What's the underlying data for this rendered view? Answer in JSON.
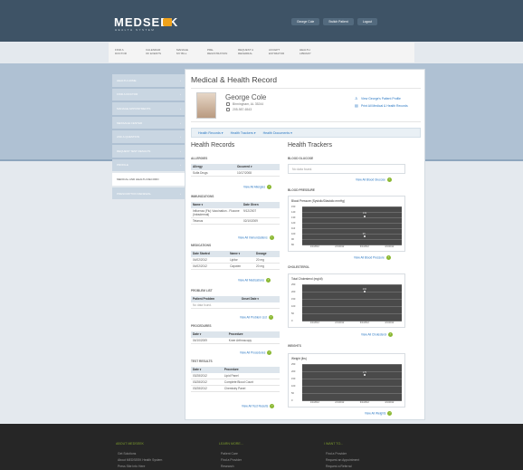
{
  "header": {
    "logo": "MEDSEEK",
    "logo_sub": "HEALTH SYSTEM",
    "user_links": [
      "George Cole",
      "Switch Patient",
      "Logout"
    ]
  },
  "topnav": [
    "FIND A\nDOCTOR",
    "CALENDAR\nOF EVENTS",
    "MANAGE\nMY BILL",
    "PRE-\nREGISTRATION",
    "REQUEST A\nREFERRAL",
    "ACCEPT\nESTIMATOR",
    "HEALTH\nLIBRARY"
  ],
  "sidebar": [
    "HEALTH HOME",
    "FIND A DOCTOR",
    "MANAGE APPOINTMENTS",
    "MESSAGE CENTER",
    "ASK A QUESTION",
    "REQUEST TEST RESULTS",
    "PROFILE",
    "MEDICAL AND HEALTH RECORD",
    "PRESCRIPTION RENEWAL"
  ],
  "main": {
    "title": "Medical & Health Record"
  },
  "profile": {
    "name": "George Cole",
    "address": "Birmingham, AL 35244",
    "phone": "205-987-6543",
    "link1": "View George's Patient Profile",
    "link2": "Print All Medical & Health Records"
  },
  "tabs": [
    "Health Records",
    "Health Trackers",
    "Health Documents"
  ],
  "records": {
    "heading": "Health Records",
    "allergies": {
      "title": "ALLERGIES",
      "headers": [
        "Allergy",
        "Occurred"
      ],
      "rows": [
        [
          "Sulfa Drugs",
          "10/17/2008"
        ]
      ],
      "link": "View All Allergies"
    },
    "immunizations": {
      "title": "IMMUNIZATIONS",
      "headers": [
        "Name",
        "Date Given"
      ],
      "rows": [
        [
          "Influenza (Flu) Vaccination - Fluzone (Intradermal)",
          "9/12/2007"
        ],
        [
          "Tetanus",
          "02/10/2009"
        ]
      ],
      "link": "View All Immunizations"
    },
    "medications": {
      "title": "MEDICATIONS",
      "headers": [
        "Date Started",
        "Name",
        "Dosage"
      ],
      "rows": [
        [
          "04/02/2012",
          "Lipitor",
          "20 mg"
        ],
        [
          "04/02/2012",
          "Capoten",
          "20 mg"
        ]
      ],
      "link": "View All Medications"
    },
    "problems": {
      "title": "PROBLEM LIST",
      "headers": [
        "Patient Problem",
        "Onset Date"
      ],
      "empty": "No data found.",
      "link": "View All Problem List"
    },
    "procedures": {
      "title": "PROCEDURES",
      "headers": [
        "Date",
        "Procedure"
      ],
      "rows": [
        [
          "04/10/2009",
          "Knee Arthroscopy"
        ]
      ],
      "link": "View All Procedures"
    },
    "tests": {
      "title": "TEST RESULTS",
      "headers": [
        "Date",
        "Procedure"
      ],
      "rows": [
        [
          "03/28/2012",
          "Lipid Panel"
        ],
        [
          "03/28/2012",
          "Complete Blood Count"
        ],
        [
          "03/28/2012",
          "Chemistry Panel"
        ]
      ],
      "link": "View All Test Results"
    }
  },
  "trackers": {
    "heading": "Health Trackers",
    "glucose": {
      "title": "BLOOD GLUCOSE",
      "empty": "No data found.",
      "link": "View All Blood Glucose"
    },
    "pressure": {
      "title": "BLOOD PRESSURE",
      "chart_title": "Blood Pressure (Systolic/Diastolic mmHg)",
      "link": "View All Blood Pressure"
    },
    "cholesterol": {
      "title": "CHOLESTEROL",
      "chart_title": "Total Cholesterol (mg/dl)",
      "link": "View All Cholesterol"
    },
    "weights": {
      "title": "WEIGHTS",
      "chart_title": "Weight (lbs)",
      "link": "View All Weights"
    }
  },
  "footer": {
    "col1": {
      "title": "ABOUT MEDSEEK",
      "links": [
        "Get Solutions",
        "About MEDSEEK Health System",
        "Press Site Info Here"
      ]
    },
    "col2": {
      "title": "LEARN MORE...",
      "links": [
        "Patient Care",
        "Find a Provider",
        "Research"
      ]
    },
    "col3": {
      "title": "I WANT TO...",
      "links": [
        "Find a Provider",
        "Request an Appointment",
        "Request a Referral"
      ]
    }
  },
  "chart_data": [
    {
      "type": "line",
      "title": "Blood Pressure (Systolic/Diastolic mmHg)",
      "categories": [
        "1/1/2012",
        "2/1/2012",
        "3/1/2012",
        "4/1/2012"
      ],
      "ylim": [
        80,
        150
      ],
      "yticks": [
        80,
        90,
        100,
        110,
        120,
        130,
        140,
        150
      ],
      "series": [
        {
          "values": [
            null,
            null,
            132,
            null
          ]
        },
        {
          "values": [
            null,
            null,
            95,
            null
          ]
        }
      ],
      "labels": [
        "132",
        "95"
      ]
    },
    {
      "type": "line",
      "title": "Total Cholesterol (mg/dl)",
      "categories": [
        "1/1/2012",
        "2/1/2012",
        "3/1/2012",
        "4/1/2012"
      ],
      "ylim": [
        0,
        250
      ],
      "yticks": [
        0,
        50,
        100,
        150,
        200,
        250
      ],
      "series": [
        {
          "values": [
            null,
            null,
            200,
            null
          ]
        }
      ],
      "labels": [
        "200"
      ]
    },
    {
      "type": "line",
      "title": "Weight (lbs)",
      "categories": [
        "1/1/2012",
        "2/1/2012",
        "3/1/2012",
        "4/1/2012"
      ],
      "ylim": [
        0,
        250
      ],
      "yticks": [
        0,
        50,
        100,
        150,
        200,
        250
      ],
      "series": [
        {
          "values": [
            null,
            null,
            175,
            null
          ]
        }
      ],
      "labels": [
        "175"
      ]
    }
  ]
}
